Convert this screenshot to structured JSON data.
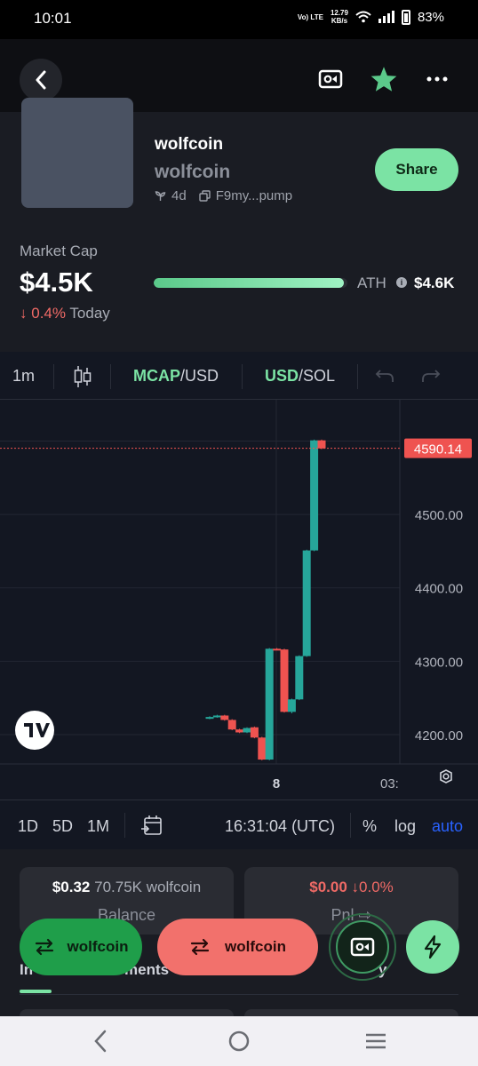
{
  "status_bar": {
    "time": "10:01",
    "net_type": "Vo) LTE",
    "net_speed": "12.79",
    "net_unit": "KB/s",
    "battery": "83%"
  },
  "token": {
    "name": "wolfcoin",
    "symbol": "wolfcoin",
    "age": "4d",
    "address": "F9my...pump",
    "share_label": "Share"
  },
  "market": {
    "label": "Market Cap",
    "value": "$4.5K",
    "change": "0.4%",
    "change_period": "Today",
    "ath_label": "ATH",
    "ath_value": "$4.6K",
    "ath_progress": 0.98
  },
  "toolbar": {
    "interval": "1m",
    "mcap": "MCAP",
    "mcap_unit": "/USD",
    "usd": "USD",
    "usd_unit": "/SOL"
  },
  "chart_bottom": {
    "d1": "1D",
    "d5": "5D",
    "m1": "1M",
    "time": "16:31:04 (UTC)",
    "pct": "%",
    "log": "log",
    "auto": "auto"
  },
  "chart_data": {
    "type": "candlestick",
    "y_ticks": [
      "4200.00",
      "4300.00",
      "4400.00",
      "4500.00"
    ],
    "ylim": [
      4160,
      4620
    ],
    "x_tick_labels": [
      "8",
      "03:"
    ],
    "last_price_label": "4590.14",
    "last_price": 4590.14,
    "up_color": "#26a69a",
    "down_color": "#ef5350",
    "candles": [
      {
        "o": 4222,
        "c": 4224,
        "h": 4225,
        "l": 4221
      },
      {
        "o": 4224,
        "c": 4226,
        "h": 4227,
        "l": 4223
      },
      {
        "o": 4226,
        "c": 4220,
        "h": 4227,
        "l": 4219
      },
      {
        "o": 4220,
        "c": 4207,
        "h": 4221,
        "l": 4206
      },
      {
        "o": 4207,
        "c": 4203,
        "h": 4208,
        "l": 4202
      },
      {
        "o": 4203,
        "c": 4209,
        "h": 4210,
        "l": 4202
      },
      {
        "o": 4210,
        "c": 4196,
        "h": 4211,
        "l": 4195
      },
      {
        "o": 4196,
        "c": 4166,
        "h": 4197,
        "l": 4165
      },
      {
        "o": 4166,
        "c": 4317,
        "h": 4318,
        "l": 4165
      },
      {
        "o": 4317,
        "c": 4316,
        "h": 4318,
        "l": 4315
      },
      {
        "o": 4316,
        "c": 4231,
        "h": 4317,
        "l": 4230
      },
      {
        "o": 4231,
        "c": 4248,
        "h": 4249,
        "l": 4229
      },
      {
        "o": 4248,
        "c": 4307,
        "h": 4308,
        "l": 4247
      },
      {
        "o": 4307,
        "c": 4451,
        "h": 4452,
        "l": 4306
      },
      {
        "o": 4451,
        "c": 4601,
        "h": 4602,
        "l": 4450
      },
      {
        "o": 4601,
        "c": 4590,
        "h": 4602,
        "l": 4589
      }
    ]
  },
  "balance": {
    "amount": "$0.32",
    "holding": "70.75K wolfcoin",
    "label": "Balance"
  },
  "pnl": {
    "amount": "$0.00",
    "change": "0.0%",
    "label": "Pnl"
  },
  "tabs": {
    "first": "In",
    "second": "ments",
    "third": "y"
  },
  "actions": {
    "buy_label": "wolfcoin",
    "sell_label": "wolfcoin"
  },
  "colors": {
    "accent_green": "#7be3a4",
    "buy_green": "#1f9e4a",
    "sell_red": "#f2716c",
    "negative": "#f06a66"
  }
}
